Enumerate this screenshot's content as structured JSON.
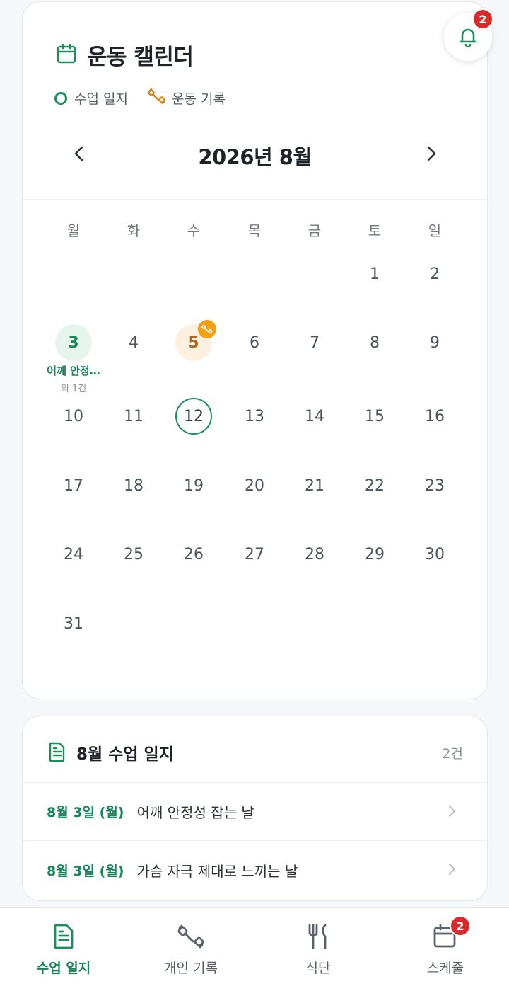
{
  "calendar": {
    "title": "운동 캘린더",
    "legend": {
      "log_label": "수업 일지",
      "workout_label": "운동 기록"
    },
    "month_label": "2026년 8월",
    "weekdays": [
      "월",
      "화",
      "수",
      "목",
      "금",
      "토",
      "일"
    ],
    "days": [
      "1",
      "2",
      "3",
      "4",
      "5",
      "6",
      "7",
      "8",
      "9",
      "10",
      "11",
      "12",
      "13",
      "14",
      "15",
      "16",
      "17",
      "18",
      "19",
      "20",
      "21",
      "22",
      "23",
      "24",
      "25",
      "26",
      "27",
      "28",
      "29",
      "30",
      "31"
    ],
    "day3_note": {
      "title": "어깨 안정…",
      "more": "외 1건"
    }
  },
  "notifications": {
    "count": "2"
  },
  "logs": {
    "title": "8월 수업 일지",
    "count": "2건",
    "items": [
      {
        "date": "8월 3일 (월)",
        "text": "어깨 안정성 잡는 날"
      },
      {
        "date": "8월 3일 (월)",
        "text": "가슴 자극 제대로 느끼는 날"
      }
    ]
  },
  "nav": {
    "items": [
      {
        "label": "수업 일지"
      },
      {
        "label": "개인 기록"
      },
      {
        "label": "식단"
      },
      {
        "label": "스케줄",
        "badge": "2"
      }
    ]
  },
  "colors": {
    "accent": "#1a8f5c",
    "workout": "#f0a010",
    "badge": "#d92b2b"
  },
  "icons": [
    "calendar-icon",
    "dumbbell-icon",
    "chevron-left-icon",
    "chevron-right-icon",
    "bell-icon",
    "document-icon",
    "fork-knife-icon",
    "calendar-clock-icon"
  ]
}
